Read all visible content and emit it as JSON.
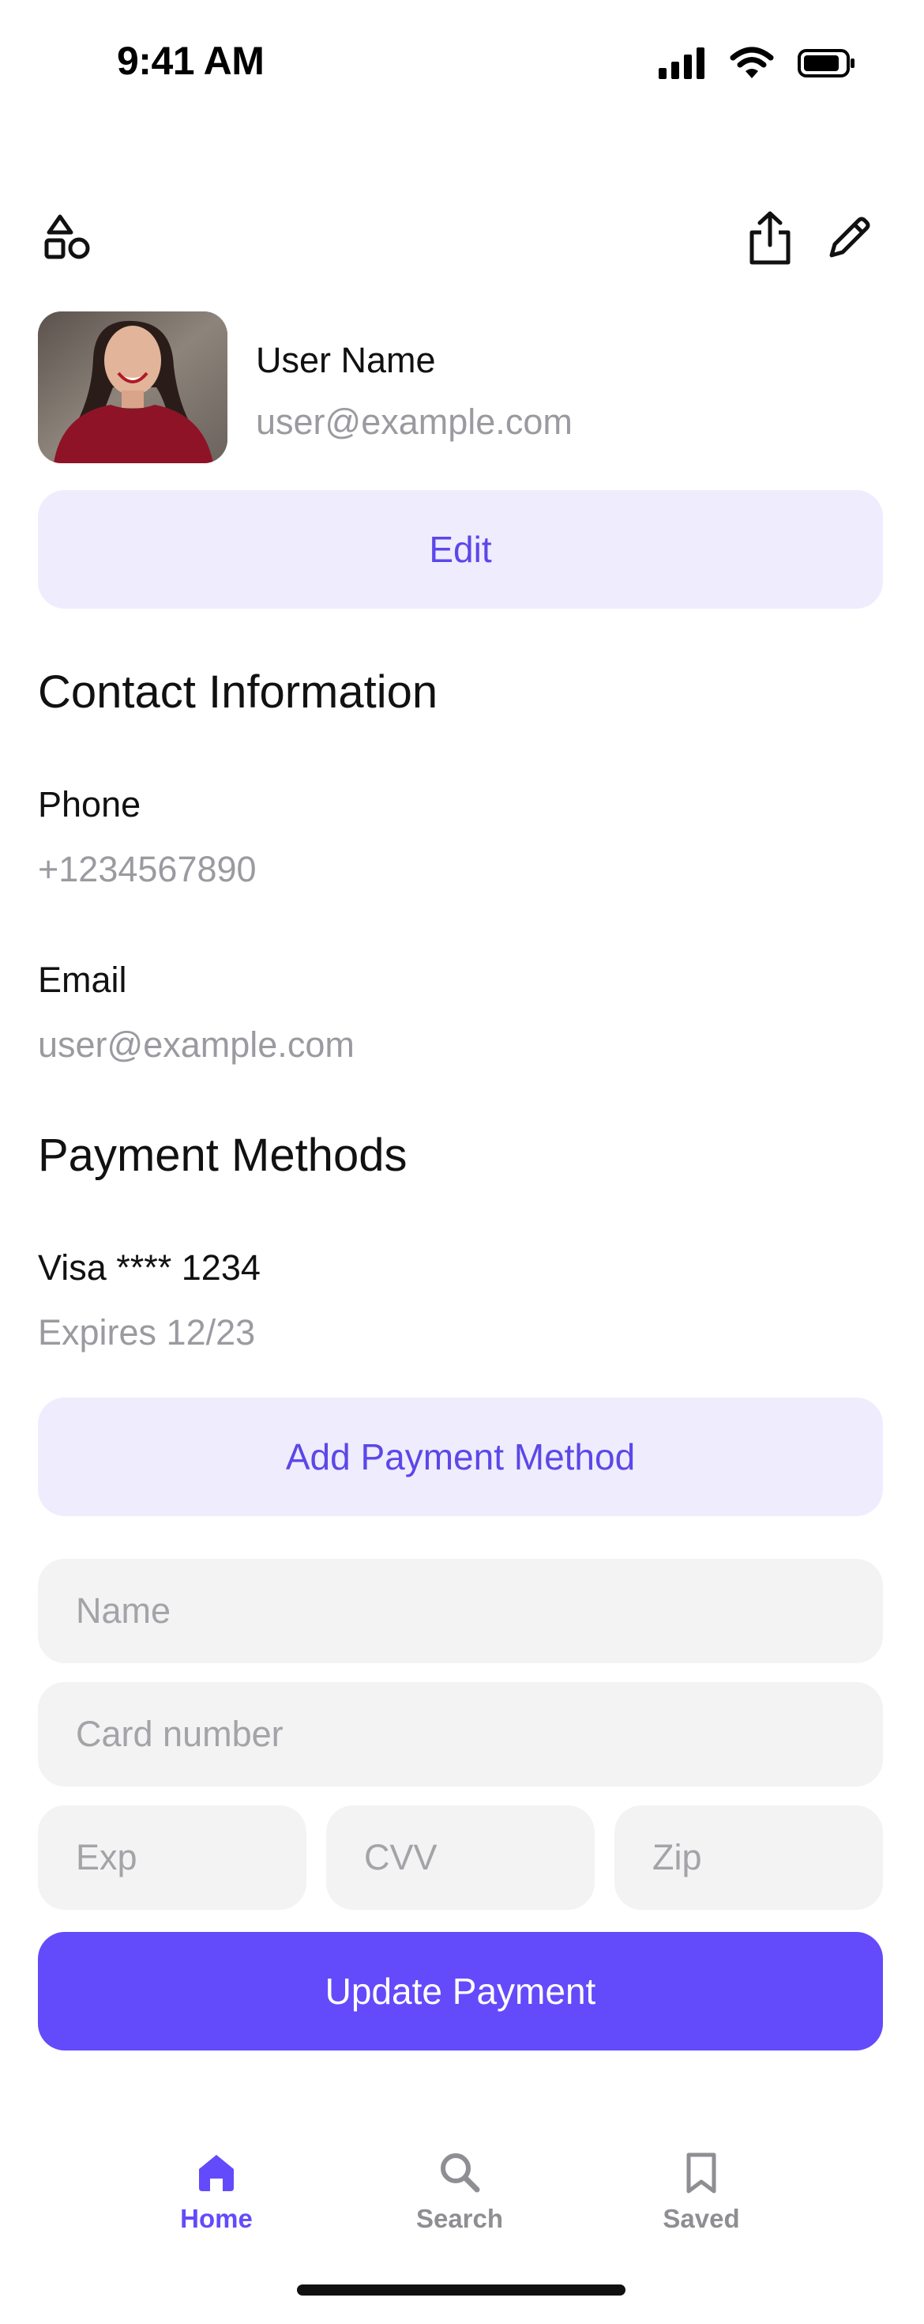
{
  "status_bar": {
    "time": "9:41 AM"
  },
  "toolbar": {
    "left_icon": "shapes-icon",
    "right_icons": [
      "share-icon",
      "pencil-icon"
    ]
  },
  "profile": {
    "name": "User Name",
    "email": "user@example.com",
    "edit_label": "Edit"
  },
  "contact": {
    "title": "Contact Information",
    "phone_label": "Phone",
    "phone_value": "+1234567890",
    "email_label": "Email",
    "email_value": "user@example.com"
  },
  "payment": {
    "title": "Payment Methods",
    "card_label": "Visa **** 1234",
    "card_expiry": "Expires 12/23",
    "add_label": "Add Payment Method",
    "name_placeholder": "Name",
    "card_number_placeholder": "Card number",
    "exp_placeholder": "Exp",
    "cvv_placeholder": "CVV",
    "zip_placeholder": "Zip",
    "update_label": "Update Payment"
  },
  "tabbar": {
    "home": "Home",
    "search": "Search",
    "saved": "Saved"
  },
  "colors": {
    "accent": "#634bfb",
    "accent_soft": "#efecfd",
    "muted_text": "#9a9aa0",
    "inactive_tab": "#8e8e93"
  }
}
